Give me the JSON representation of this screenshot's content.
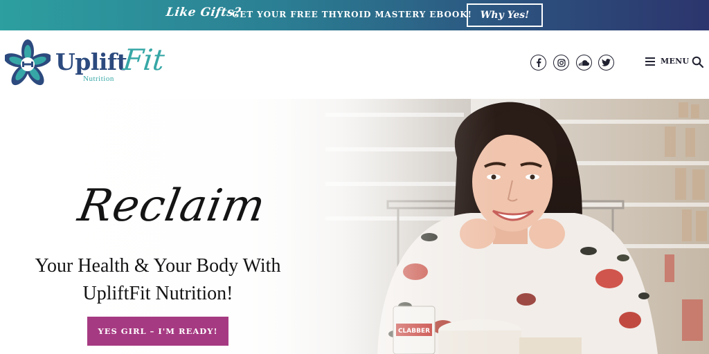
{
  "promo": {
    "script_text": "Like Gifts?",
    "text": "GET YOUR FREE THYROID MASTERY EBOOK!",
    "button_label": "Why Yes!"
  },
  "logo": {
    "primary": "Uplift",
    "secondary": "Fit",
    "tagline": "Nutrition"
  },
  "social": [
    "facebook-icon",
    "instagram-icon",
    "soundcloud-icon",
    "twitter-icon"
  ],
  "nav": {
    "menu_label": "MENU"
  },
  "hero": {
    "script_heading": "Reclaim",
    "line1": "Your Health & Your Body With",
    "line2": "UpliftFit Nutrition!",
    "cta_label": "YES GIRL – I'M READY!"
  },
  "colors": {
    "teal": "#36a7a6",
    "navy": "#2c4a7e",
    "cta": "#a63a82"
  }
}
